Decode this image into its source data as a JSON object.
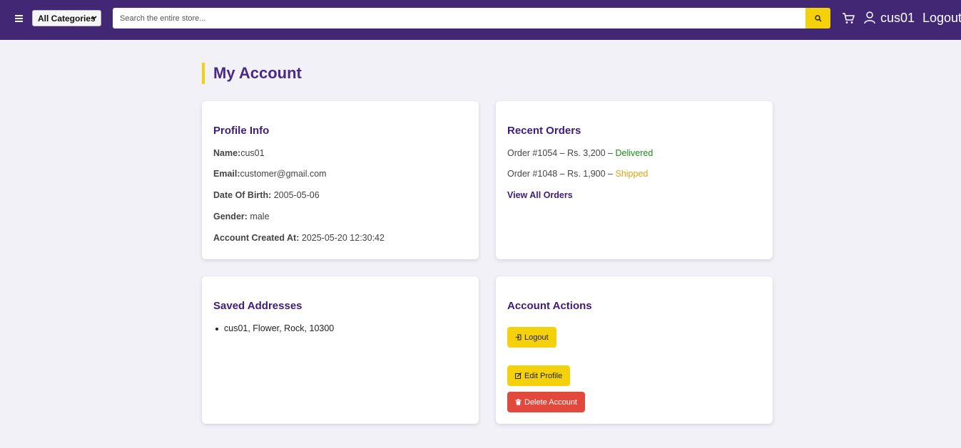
{
  "header": {
    "category_select": "All Categories",
    "search_placeholder": "Search the entire store...",
    "username": "cus01",
    "logout": "Logout"
  },
  "page_title": "My Account",
  "profile": {
    "heading": "Profile Info",
    "name_label": "Name:",
    "name_value": "cus01",
    "email_label": "Email:",
    "email_value": "customer@gmail.com",
    "dob_label": "Date Of Birth:",
    "dob_value": "2005-05-06",
    "gender_label": "Gender:",
    "gender_value": "male",
    "created_label": "Account Created At:",
    "created_value": "2025-05-20 12:30:42"
  },
  "orders": {
    "heading": "Recent Orders",
    "items": [
      {
        "text": "Order #1054 – Rs. 3,200 – ",
        "status": "Delivered",
        "status_color": "#1a8a1a"
      },
      {
        "text": "Order #1048 – Rs. 1,900 – ",
        "status": "Shipped",
        "status_color": "#e5a10f"
      }
    ],
    "view_all": "View All Orders"
  },
  "addresses": {
    "heading": "Saved Addresses",
    "items": [
      "cus01, Flower, Rock, 10300"
    ]
  },
  "actions": {
    "heading": "Account Actions",
    "logout": "Logout",
    "edit_profile": "Edit Profile",
    "delete_account": "Delete Account"
  },
  "colors": {
    "header_bg": "#422874",
    "accent_yellow": "#f5d10b",
    "heading_purple": "#3e1c7a",
    "danger": "#e2483c"
  }
}
